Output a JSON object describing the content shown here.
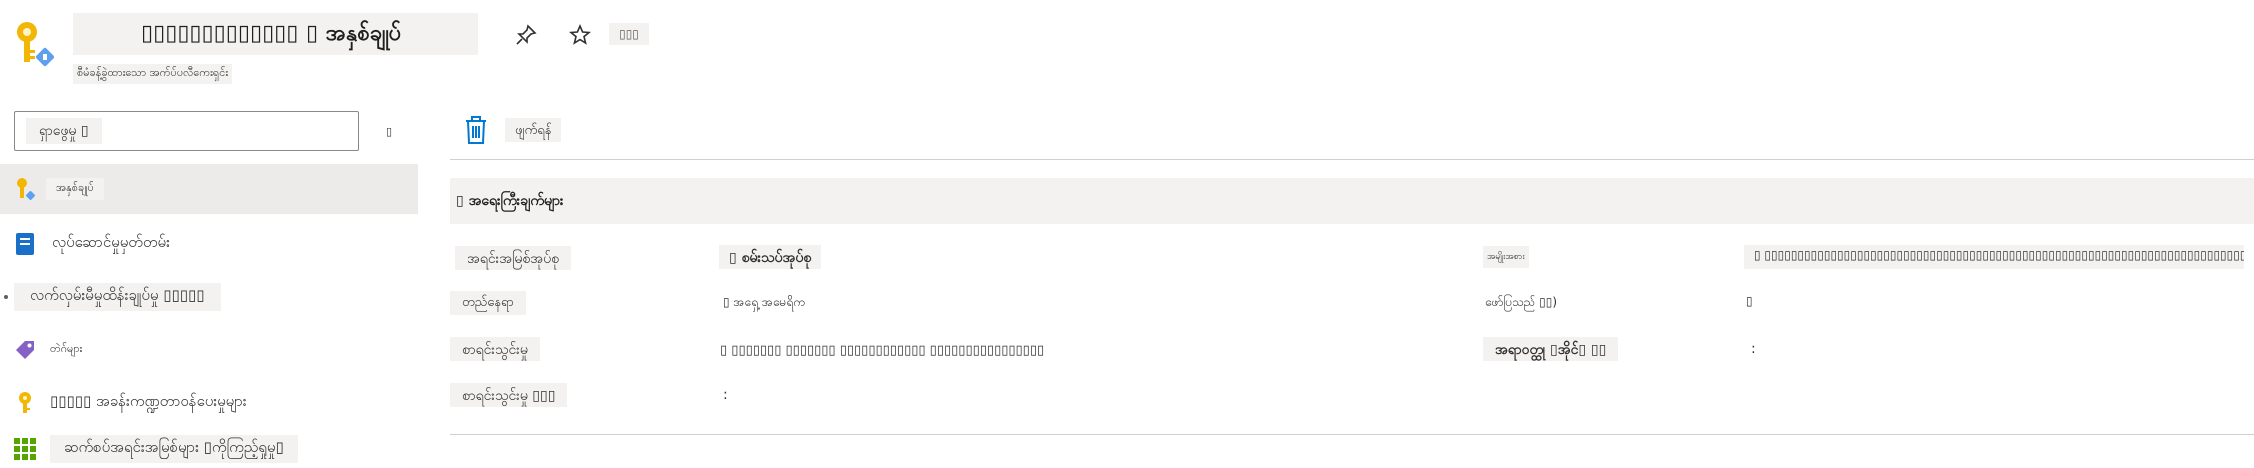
{
  "header": {
    "title": "▯▯▯▯▯▯▯▯▯▯▯▯▯ ▯ အနှစ်ချုပ်",
    "subtitle": "စီမံခန့်ခွဲထားသော အက်ပ်ပလီကေးရှင်း",
    "pin_icon": "pin-icon",
    "favorite_icon": "star-icon",
    "more_label": "▯▯▯"
  },
  "nav": {
    "search_placeholder": "ရှာဖွေမှု ▯",
    "collapse_label": "▯",
    "items": [
      {
        "label": "အနှစ်ချုပ်",
        "icon": "overview-icon",
        "selected": true
      },
      {
        "label": "လုပ်ဆောင်မှုမှတ်တမ်း",
        "icon": "activity-log-icon"
      },
      {
        "label": "လက်လှမ်းမီမှုထိန်းချုပ်မှု ▯▯▯▯▯",
        "icon": "access-control-icon"
      },
      {
        "label": "တဲဂ်များ",
        "icon": "tag-icon"
      },
      {
        "label": "▯▯▯▯▯ အခန်းကဏ္ဍတာဝန်ပေးမှုများ",
        "icon": "key-icon"
      },
      {
        "label": "ဆက်စပ်အရင်းအမြစ်များ ▯ကိုကြည့်ရှုမှု▯",
        "icon": "grid-icon"
      }
    ]
  },
  "commands": {
    "delete_label": "ဖျက်ရန်"
  },
  "essentials": {
    "header": "▯ အရေးကြီးချက်များ",
    "rows": [
      {
        "label": "အရင်းအမြစ်အုပ်စု",
        "value": "▯ စမ်းသပ်အုပ်စု"
      },
      {
        "label": "တည်နေရာ",
        "value": "▯ အရှေ့ အမေရိက"
      },
      {
        "label": "စာရင်းသွင်းမှု",
        "value": "▯ ▯▯▯▯▯▯▯ ▯▯▯▯▯▯▯ ▯▯▯▯▯▯▯▯▯▯▯▯ ▯▯▯▯▯▯▯▯▯▯▯▯▯▯▯▯"
      },
      {
        "label": "စာရင်းသွင်းမှု ▯▯▯",
        "value": ":"
      }
    ],
    "right_rows": [
      {
        "label": "အမျိုးအစား",
        "value": "▯ ▯▯▯▯▯▯▯▯▯▯▯▯▯▯▯▯▯▯▯▯▯▯▯▯▯▯▯▯▯▯▯▯▯▯▯▯▯▯▯▯▯▯▯▯▯▯▯▯▯▯▯▯▯▯▯▯▯▯▯▯▯▯▯▯▯▯▯▯▯▯▯▯▯▯▯▯▯"
      },
      {
        "label": "ဖော်ပြသည် ▯▯)",
        "value": "▯"
      },
      {
        "label": "အရာဝတ္ထု ▯အိုင်▯ ▯▯",
        "value": ":"
      }
    ]
  },
  "colors": {
    "accent": "#0078d4",
    "key_yellow": "#f2b705",
    "selected_bg": "#edebe9",
    "placeholder_bg": "#f3f2f1"
  }
}
